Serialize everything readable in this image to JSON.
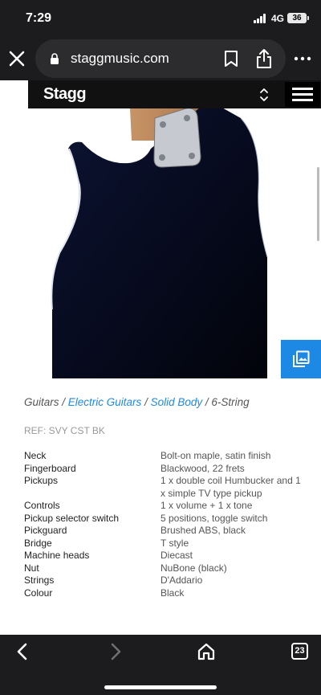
{
  "status_bar": {
    "time": "7:29",
    "network": "4G",
    "battery": "36"
  },
  "browser": {
    "url": "staggmusic.com",
    "tab_count": "23",
    "icons": [
      "close-icon",
      "lock-icon",
      "bookmark-icon",
      "share-icon",
      "more-icon",
      "back-icon",
      "forward-icon",
      "home-icon",
      "tabs-icon"
    ]
  },
  "site": {
    "logo": "Stagg",
    "icons": [
      "sort-arrows-icon",
      "hamburger-menu-icon",
      "gallery-icon"
    ]
  },
  "breadcrumb": [
    {
      "label": "Guitars",
      "link": false
    },
    {
      "label": "Electric Guitars",
      "link": true
    },
    {
      "label": "Solid Body",
      "link": true
    },
    {
      "label": "6-String",
      "link": false
    }
  ],
  "product": {
    "ref": "REF: SVY CST BK",
    "specs": [
      {
        "label": "Neck",
        "value": "Bolt-on maple, satin finish"
      },
      {
        "label": "Fingerboard",
        "value": "Blackwood, 22 frets"
      },
      {
        "label": "Pickups",
        "value": "1 x double coil Humbucker and 1 x simple TV type pickup"
      },
      {
        "label": "Controls",
        "value": "1 x volume + 1 x tone"
      },
      {
        "label": "Pickup selector switch",
        "value": "5 positions, toggle switch"
      },
      {
        "label": "Pickguard",
        "value": "Brushed ABS, black"
      },
      {
        "label": "Bridge",
        "value": "T style"
      },
      {
        "label": "Machine heads",
        "value": "Diecast"
      },
      {
        "label": "Nut",
        "value": "NuBone (black)"
      },
      {
        "label": "Strings",
        "value": "D'Addario"
      },
      {
        "label": "Colour",
        "value": "Black"
      }
    ]
  },
  "colors": {
    "accent": "#1e88e5",
    "chrome": "#1c1c1e",
    "guitar_body": "#0b1230"
  }
}
